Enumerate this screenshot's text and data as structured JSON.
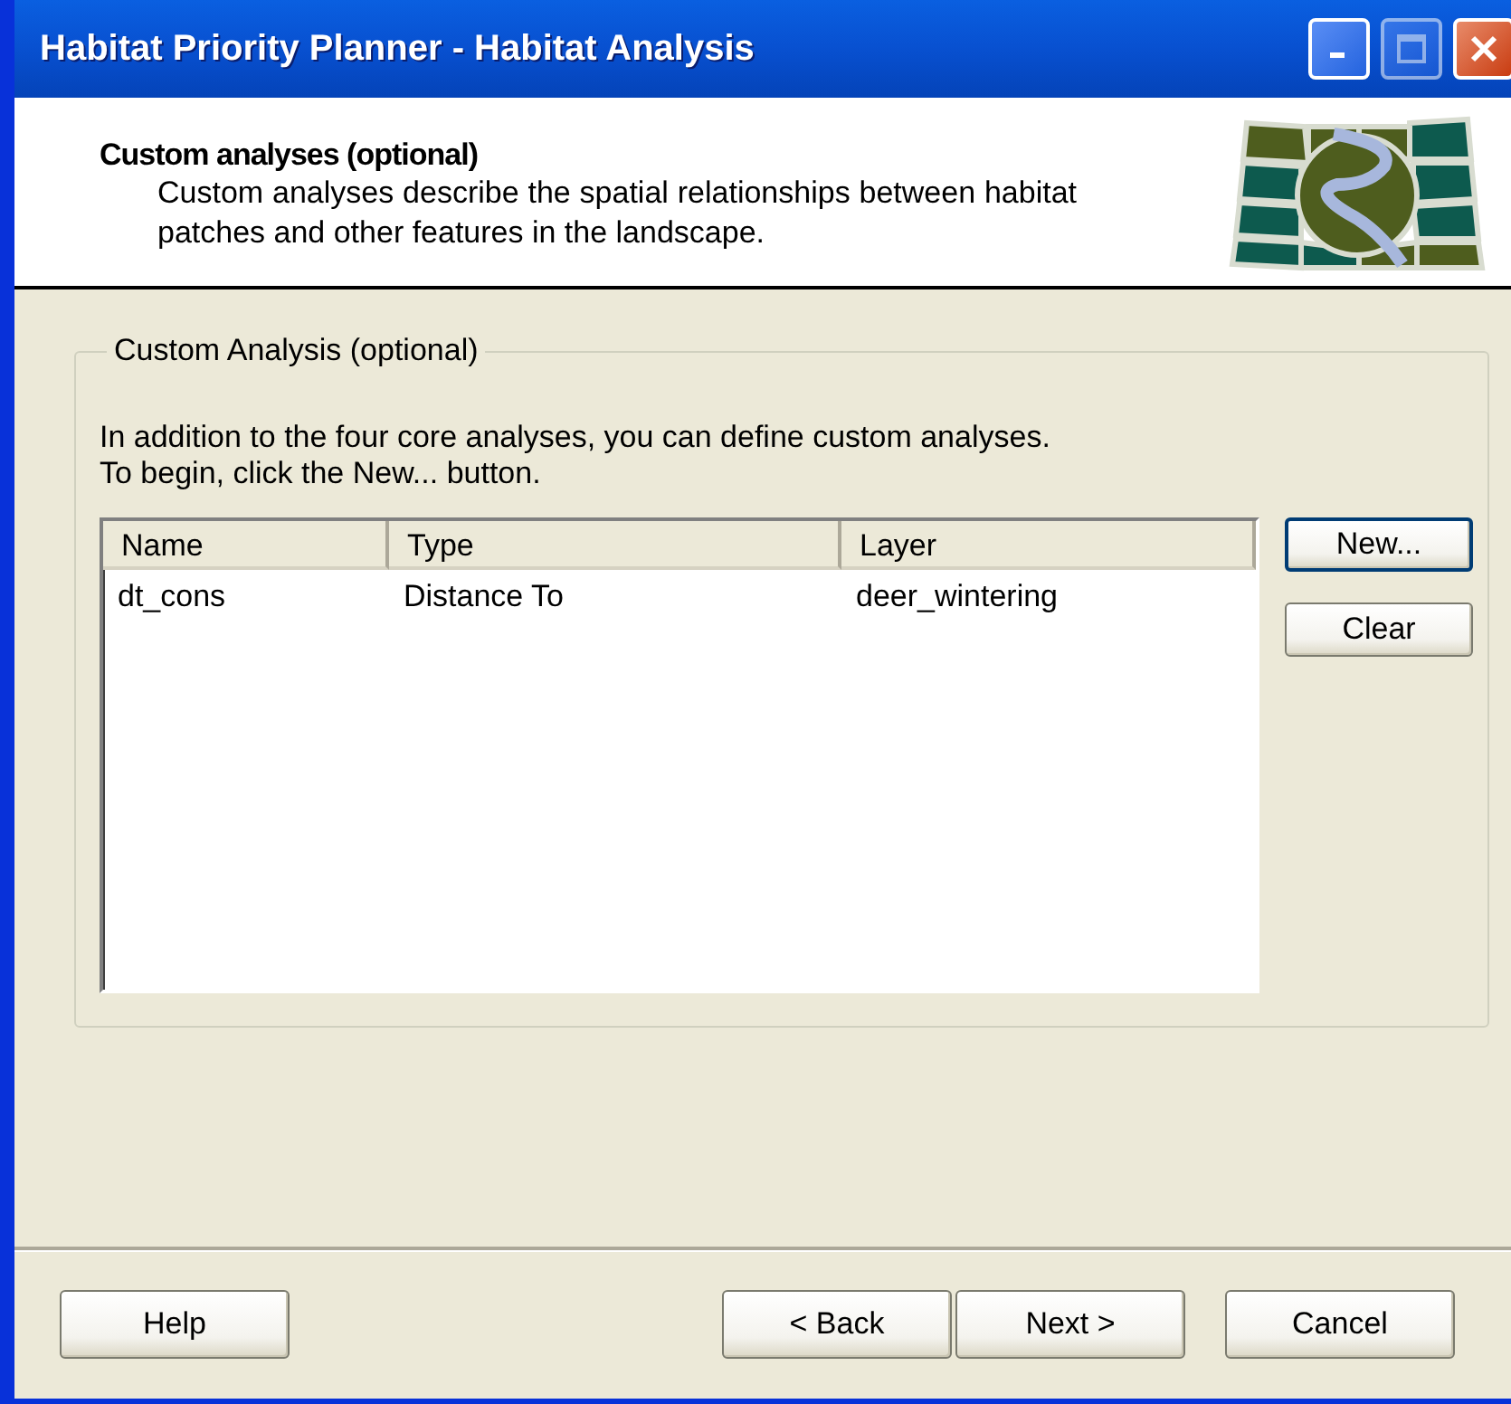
{
  "window": {
    "title": "Habitat Priority Planner - Habitat Analysis",
    "title_buttons": [
      {
        "kind": "minimize",
        "disabled": false
      },
      {
        "kind": "maximize",
        "disabled": true
      },
      {
        "kind": "close",
        "disabled": false
      }
    ]
  },
  "header": {
    "title": "Custom analyses (optional)",
    "description": "Custom analyses describe the spatial relationships between habitat patches and other features in the landscape."
  },
  "group": {
    "title": "Custom Analysis (optional)",
    "instructions": [
      "In addition to the four core analyses, you can define custom analyses.",
      "To begin, click the New... button."
    ],
    "table": {
      "columns": [
        "Name",
        "Type",
        "Layer"
      ],
      "rows": [
        {
          "cells": [
            "dt_cons",
            "Distance To",
            "deer_wintering"
          ],
          "selected": false
        }
      ]
    },
    "buttons": [
      {
        "label": "New...",
        "default": true
      },
      {
        "label": "Clear",
        "default": false
      }
    ]
  },
  "footer": {
    "buttons": [
      {
        "label": "Help",
        "kind": "left"
      },
      {
        "label": "< Back",
        "kind": "right"
      },
      {
        "label": "Next >",
        "kind": "right"
      },
      {
        "label": "Cancel",
        "kind": "far"
      }
    ]
  }
}
